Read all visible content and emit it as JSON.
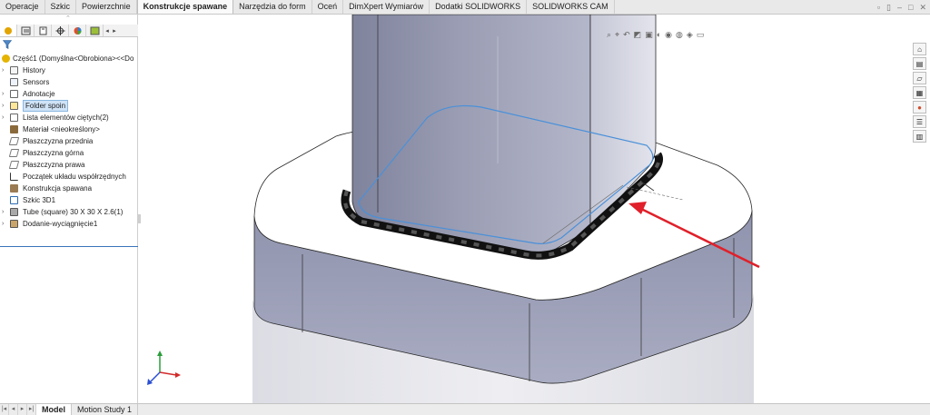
{
  "command_tabs": [
    "Operacje",
    "Szkic",
    "Powierzchnie",
    "Konstrukcje spawane",
    "Narzędzia do form",
    "Oceń",
    "DimXpert Wymiarów",
    "Dodatki SOLIDWORKS",
    "SOLIDWORKS CAM"
  ],
  "active_command_tab": "Konstrukcje spawane",
  "feature_tree": {
    "root": "Część1  (Domyślna<Obrobiona><<Do",
    "items": [
      {
        "label": "History",
        "expandable": true
      },
      {
        "label": "Sensors",
        "expandable": false
      },
      {
        "label": "Adnotacje",
        "expandable": true
      },
      {
        "label": "Folder spoin",
        "expandable": true,
        "selected": true
      },
      {
        "label": "Lista elementów ciętych(2)",
        "expandable": true
      },
      {
        "label": "Materiał <nieokreślony>",
        "expandable": false
      },
      {
        "label": "Płaszczyzna przednia",
        "expandable": false
      },
      {
        "label": "Płaszczyzna górna",
        "expandable": false
      },
      {
        "label": "Płaszczyzna prawa",
        "expandable": false
      },
      {
        "label": "Początek układu współrzędnych",
        "expandable": false
      },
      {
        "label": "Konstrukcja spawana",
        "expandable": false
      },
      {
        "label": "Szkic 3D1",
        "expandable": false
      },
      {
        "label": "Tube (square) 30 X 30 X 2.6(1)",
        "expandable": true
      },
      {
        "label": "Dodanie-wyciągnięcie1",
        "expandable": true
      }
    ]
  },
  "bottom_tabs": [
    "Model",
    "Motion Study 1"
  ],
  "active_bottom_tab": "Model",
  "colors": {
    "selection": "#cfe3f7",
    "arrow": "#e0202a",
    "edge_highlight": "#4a90d9",
    "weld_bead": "#111111"
  },
  "icons": {
    "filter": "filter-icon",
    "triad": "axis-triad-icon"
  }
}
